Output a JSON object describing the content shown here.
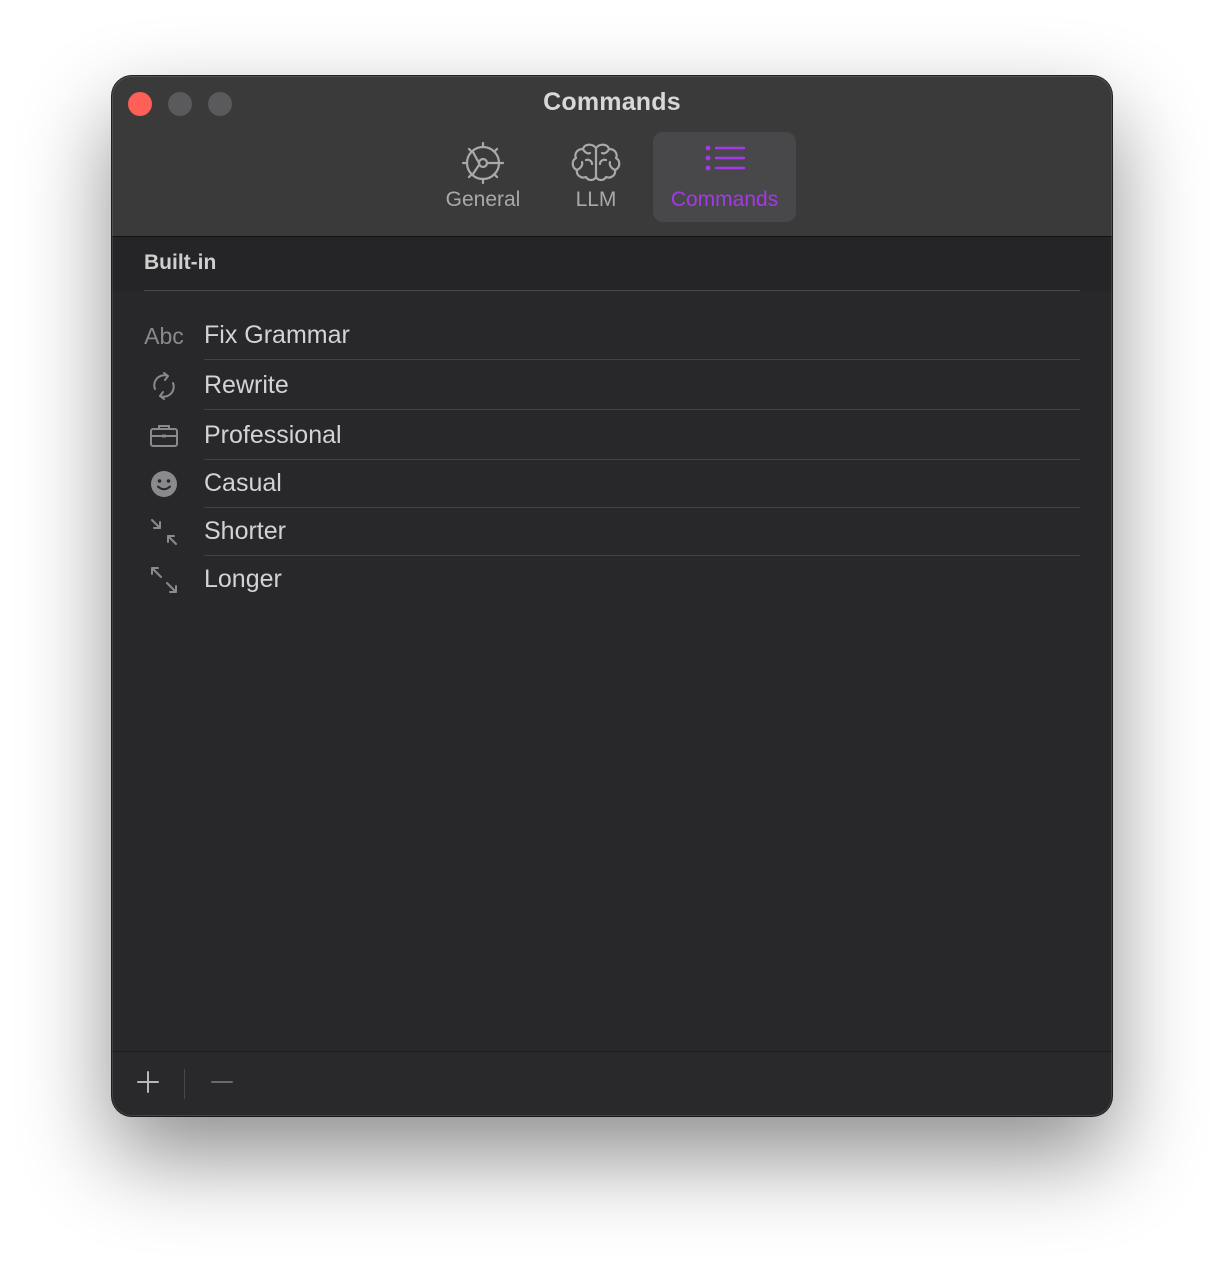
{
  "window": {
    "title": "Commands"
  },
  "toolbar": {
    "tabs": [
      {
        "label": "General",
        "icon": "gear-icon",
        "selected": false
      },
      {
        "label": "LLM",
        "icon": "brain-icon",
        "selected": false
      },
      {
        "label": "Commands",
        "icon": "list-icon",
        "selected": true
      }
    ]
  },
  "section": {
    "title": "Built-in"
  },
  "commands": [
    {
      "label": "Fix Grammar",
      "icon": "abc-icon",
      "icon_text": "Abc"
    },
    {
      "label": "Rewrite",
      "icon": "rewrite-arrows-icon"
    },
    {
      "label": "Professional",
      "icon": "briefcase-icon"
    },
    {
      "label": "Casual",
      "icon": "smiley-icon"
    },
    {
      "label": "Shorter",
      "icon": "shrink-arrows-icon"
    },
    {
      "label": "Longer",
      "icon": "expand-arrows-icon"
    }
  ],
  "footer": {
    "add_icon": "plus-icon",
    "remove_icon": "minus-icon"
  },
  "colors": {
    "accent": "#a538e8",
    "close_button": "#fe5f57",
    "window_bg": "#28282a",
    "titlebar_bg": "#3a3a3b"
  }
}
